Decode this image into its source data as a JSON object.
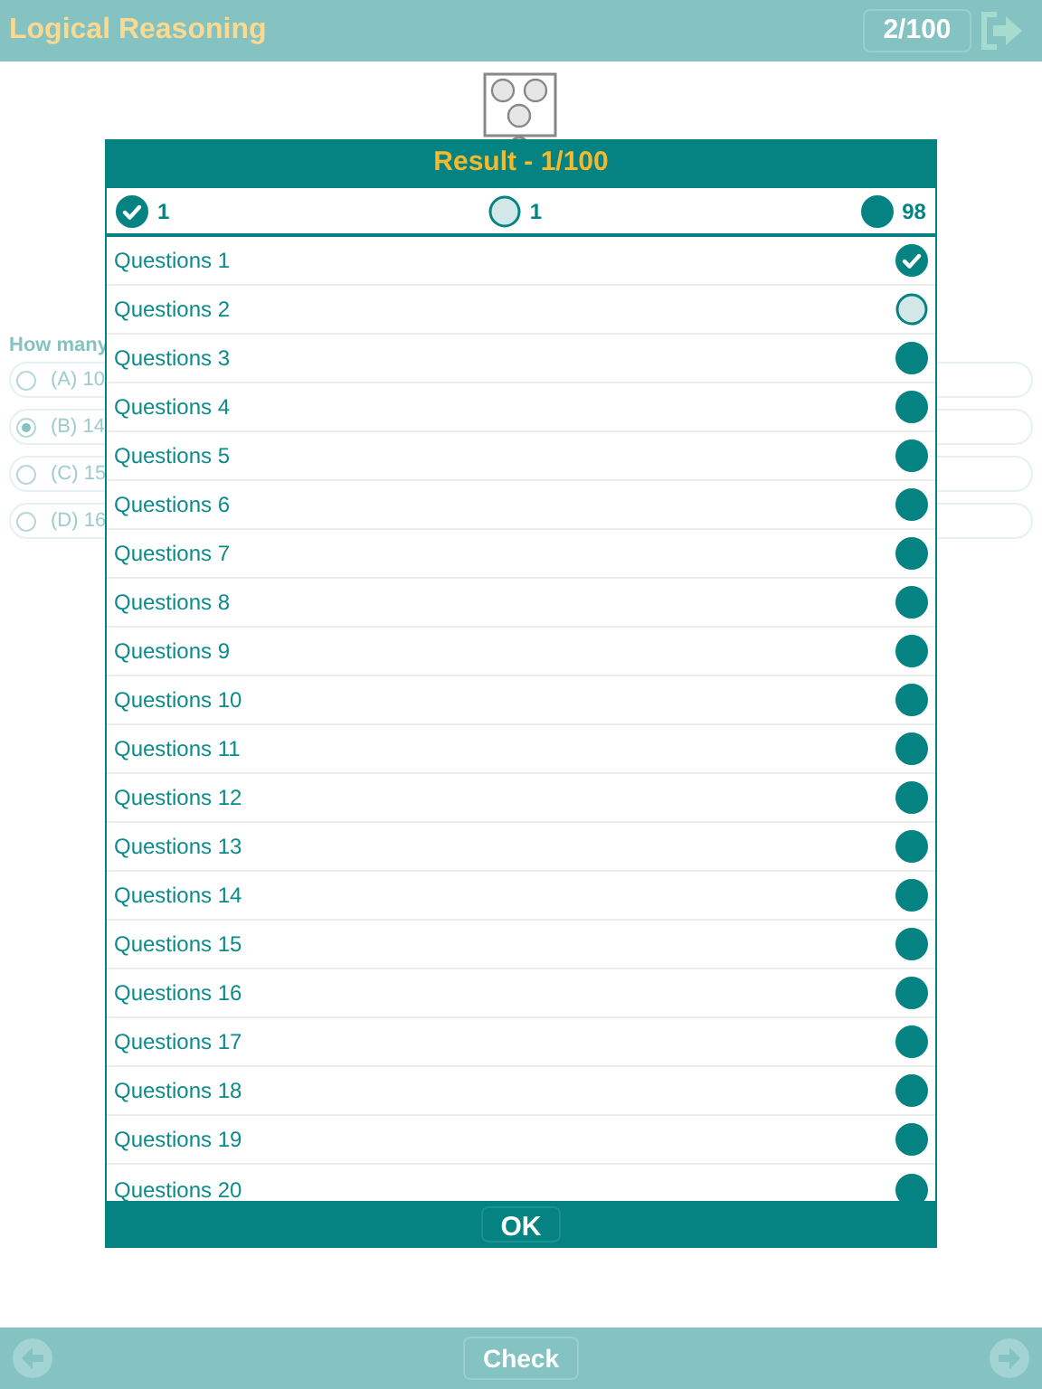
{
  "header": {
    "title": "Logical Reasoning",
    "counter": "2/100"
  },
  "question": {
    "text": "How many",
    "options": [
      {
        "label": "(A) 10",
        "selected": false
      },
      {
        "label": "(B) 14",
        "selected": true
      },
      {
        "label": "(C) 15",
        "selected": false
      },
      {
        "label": "(D) 16",
        "selected": false
      }
    ]
  },
  "result": {
    "title": "Result - 1/100",
    "summary": [
      {
        "kind": "checked",
        "count": "1"
      },
      {
        "kind": "hollow",
        "count": "1"
      },
      {
        "kind": "filled",
        "count": "98"
      }
    ],
    "rows": [
      {
        "label": "Questions 1",
        "kind": "checked"
      },
      {
        "label": "Questions 2",
        "kind": "hollow"
      },
      {
        "label": "Questions 3",
        "kind": "filled"
      },
      {
        "label": "Questions 4",
        "kind": "filled"
      },
      {
        "label": "Questions 5",
        "kind": "filled"
      },
      {
        "label": "Questions 6",
        "kind": "filled"
      },
      {
        "label": "Questions 7",
        "kind": "filled"
      },
      {
        "label": "Questions 8",
        "kind": "filled"
      },
      {
        "label": "Questions 9",
        "kind": "filled"
      },
      {
        "label": "Questions 10",
        "kind": "filled"
      },
      {
        "label": "Questions 11",
        "kind": "filled"
      },
      {
        "label": "Questions 12",
        "kind": "filled"
      },
      {
        "label": "Questions 13",
        "kind": "filled"
      },
      {
        "label": "Questions 14",
        "kind": "filled"
      },
      {
        "label": "Questions 15",
        "kind": "filled"
      },
      {
        "label": "Questions 16",
        "kind": "filled"
      },
      {
        "label": "Questions 17",
        "kind": "filled"
      },
      {
        "label": "Questions 18",
        "kind": "filled"
      },
      {
        "label": "Questions 19",
        "kind": "filled"
      },
      {
        "label": "Questions 20",
        "kind": "filled"
      }
    ],
    "ok": "OK"
  },
  "footer": {
    "check": "Check"
  }
}
